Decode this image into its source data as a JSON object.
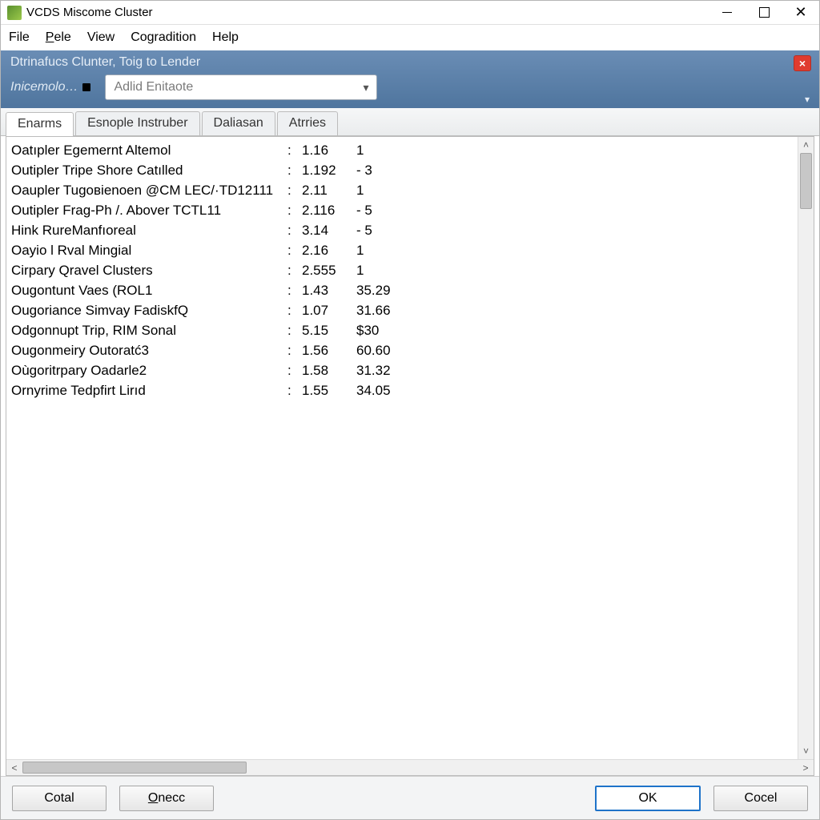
{
  "window": {
    "title": "VCDS Miscome Cluster"
  },
  "menu": {
    "file": "File",
    "pele": "Pele",
    "view": "View",
    "cogradition": "Cogradition",
    "help": "Help"
  },
  "header": {
    "line1": "Dtrinafucs Clunter, Toig to Lender",
    "line2": "Inicemolo…",
    "combo_value": "Adlid Enitaote",
    "close_x": "×",
    "overflow_glyph": "▾"
  },
  "tabs": {
    "t0": "Enarms",
    "t1": "Esnople Instruber",
    "t2": "Daliasan",
    "t3": "Atrries"
  },
  "rows": [
    {
      "label": "Oatıpler Egemernt Altemol",
      "v1": "1.16",
      "v2": "1"
    },
    {
      "label": "Outipler Tripe Shore Catılled",
      "v1": "1.192",
      "v2": "- 3"
    },
    {
      "label": "Oaupler Tugoвienoen @CM LEC/·TD12111",
      "v1": "2.11",
      "v2": "1"
    },
    {
      "label": "Outipler Frag-Ph /. Abover TCTL11",
      "v1": "2.116",
      "v2": "- 5"
    },
    {
      "label": "Hink RureManfıoreal",
      "v1": "3.14",
      "v2": "- 5"
    },
    {
      "label": "Oayio l Rval Mingial",
      "v1": "2.16",
      "v2": "1"
    },
    {
      "label": "Cirpary Qravel Clusters",
      "v1": "2.555",
      "v2": "1"
    },
    {
      "label": "Ougontunt Vaes (ROL1",
      "v1": "1.43",
      "v2": "35.29"
    },
    {
      "label": "Ougoriance Simvay FadiskfQ",
      "v1": "1.07",
      "v2": "31.66"
    },
    {
      "label": "Odgonnupt Trip, RIM Sonal",
      "v1": "5.15",
      "v2": "$30"
    },
    {
      "label": "Ougonmeiry Outoratć3",
      "v1": "1.56",
      "v2": "60.60"
    },
    {
      "label": "Oùgoritrpary Oadarle2",
      "v1": "1.58",
      "v2": "31.32"
    },
    {
      "label": "Ornyrime Tedpfirt Lirıd",
      "v1": "1.55",
      "v2": "34.05"
    }
  ],
  "buttons": {
    "cotal": "Cotal",
    "onecc": "Onecc",
    "ok": "OK",
    "cocel": "Cocel"
  }
}
